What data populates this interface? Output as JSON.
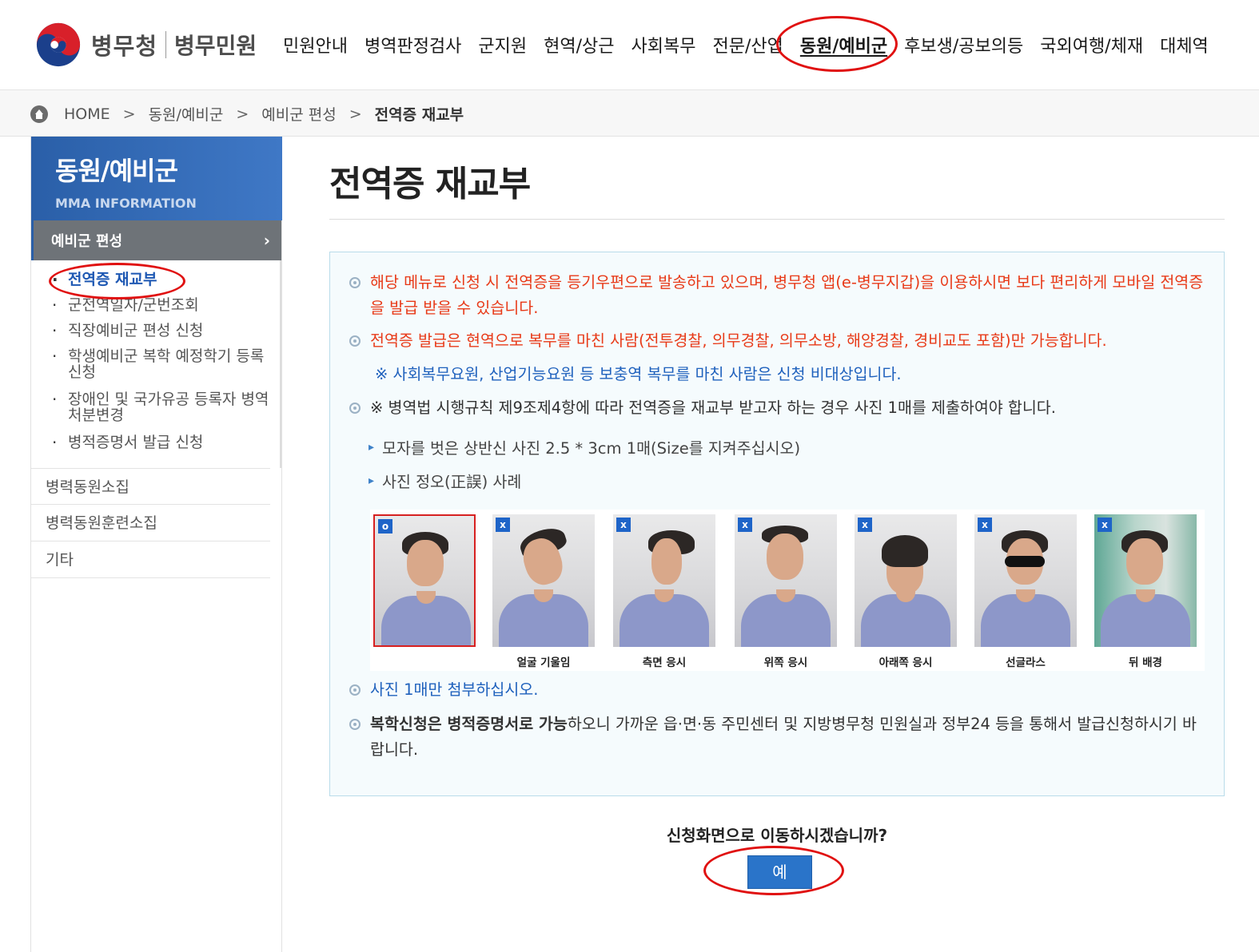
{
  "header": {
    "logo_text": "병무청",
    "logo_sub": "병무민원",
    "nav": [
      {
        "label": "민원안내",
        "active": false
      },
      {
        "label": "병역판정검사",
        "active": false
      },
      {
        "label": "군지원",
        "active": false
      },
      {
        "label": "현역/상근",
        "active": false
      },
      {
        "label": "사회복무",
        "active": false
      },
      {
        "label": "전문/산업",
        "active": false
      },
      {
        "label": "동원/예비군",
        "active": true
      },
      {
        "label": "후보생/공보의등",
        "active": false
      },
      {
        "label": "국외여행/체재",
        "active": false
      },
      {
        "label": "대체역",
        "active": false
      }
    ]
  },
  "breadcrumb": {
    "home": "HOME",
    "sep": ">",
    "level1": "동원/예비군",
    "level2": "예비군 편성",
    "current": "전역증 재교부"
  },
  "sidebar": {
    "title": "동원/예비군",
    "subtitle": "MMA INFORMATION",
    "category": "예비군 편성",
    "sub_items": [
      "전역증 재교부",
      "군전역일자/군번조회",
      "직장예비군 편성 신청",
      "학생예비군 복학 예정학기 등록 신청",
      "장애인 및 국가유공 등록자 병역처분변경",
      "병적증명서 발급 신청"
    ],
    "menu_items": [
      "병력동원소집",
      "병력동원훈련소집",
      "기타"
    ]
  },
  "main": {
    "title": "전역증 재교부",
    "notice1": "해당 메뉴로 신청 시 전역증을 등기우편으로 발송하고 있으며, 병무청 앱(e-병무지갑)을 이용하시면 보다 편리하게 모바일 전역증을 발급 받을 수 있습니다.",
    "notice2": "전역증 발급은 현역으로 복무를 마친 사람(전투경찰, 의무경찰, 의무소방, 해양경찰, 경비교도 포함)만 가능합니다.",
    "notice2_sub": "※ 사회복무요원, 산업기능요원 등 보충역 복무를 마친 사람은 신청 비대상입니다.",
    "notice3": "※ 병역법 시행규칙 제9조제4항에 따라 전역증을 재교부 받고자 하는 경우 사진 1매를 제출하여야 합니다.",
    "notice3_sub1": "모자를 벗은 상반신 사진 2.5 * 3cm 1매(Size를 지켜주십시오)",
    "notice3_sub2": "사진 정오(正誤) 사례",
    "photos": [
      {
        "mark": "o",
        "caption": ""
      },
      {
        "mark": "x",
        "caption": "얼굴 기울임"
      },
      {
        "mark": "x",
        "caption": "측면 응시"
      },
      {
        "mark": "x",
        "caption": "위쪽 응시"
      },
      {
        "mark": "x",
        "caption": "아래쪽 응시"
      },
      {
        "mark": "x",
        "caption": "선글라스"
      },
      {
        "mark": "x",
        "caption": "뒤 배경"
      }
    ],
    "notice4": "사진 1매만 첨부하십시오.",
    "notice5_bold": "복학신청은 병적증명서로 가능",
    "notice5_rest": "하오니 가까운 읍·면·동 주민센터 및 지방병무청 민원실과 정부24 등을 통해서 발급신청하시기 바랍니다.",
    "question": "신청화면으로 이동하시겠습니까?",
    "yes_button": "예"
  },
  "colors": {
    "brand_blue": "#2a5fa8",
    "notice_red": "#e83a18",
    "notice_blue": "#1f61bd",
    "annotation_red": "#e01010"
  }
}
